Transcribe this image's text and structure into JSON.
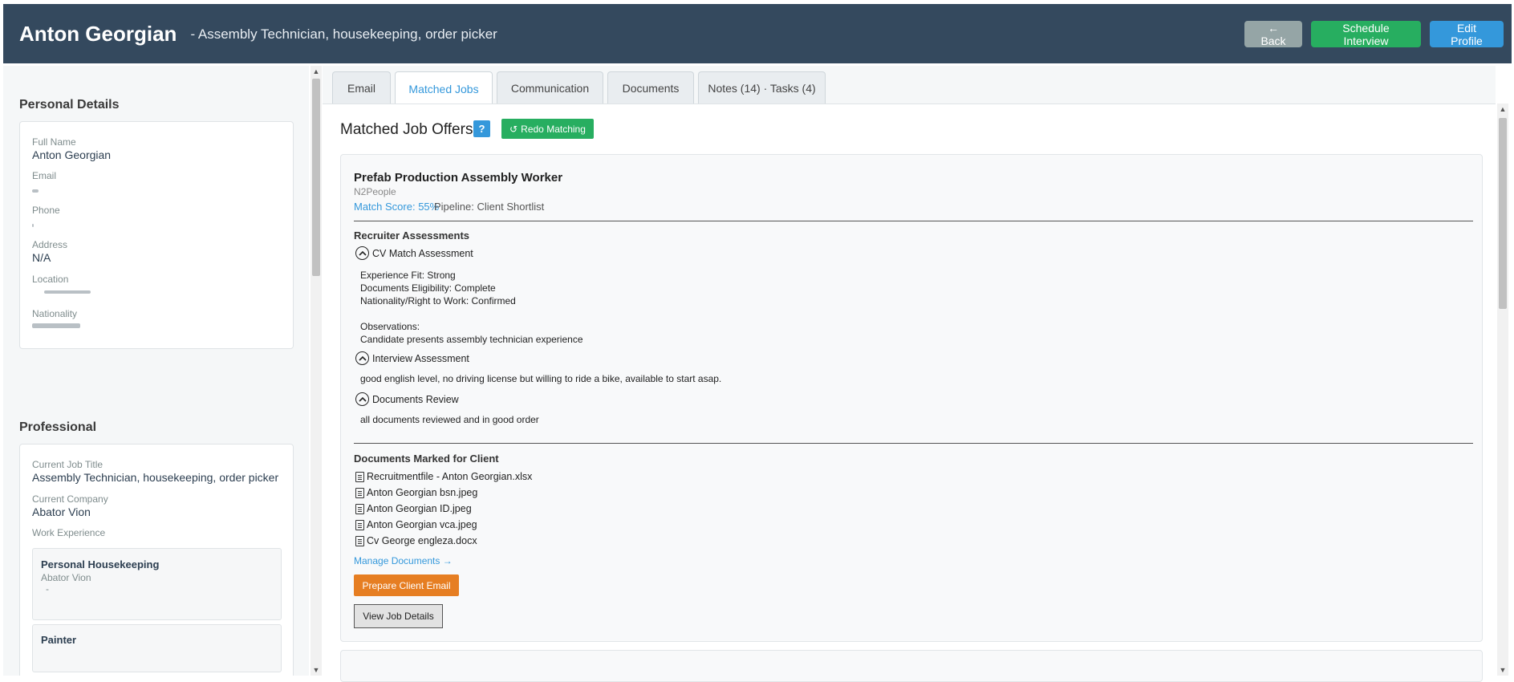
{
  "header": {
    "name": "Anton Georgian",
    "subtitle": "- Assembly Technician, housekeeping, order picker",
    "back_label": "← Back",
    "schedule_label": "Schedule Interview",
    "edit_label": "Edit Profile"
  },
  "personal": {
    "title": "Personal Details",
    "full_name_label": "Full Name",
    "full_name": "Anton Georgian",
    "email_label": "Email",
    "phone_label": "Phone",
    "address_label": "Address",
    "address": "N/A",
    "location_label": "Location",
    "nationality_label": "Nationality"
  },
  "professional": {
    "title": "Professional",
    "job_title_label": "Current Job Title",
    "job_title": "Assembly Technician, housekeeping, order picker",
    "company_label": "Current Company",
    "company": "Abator Vion",
    "work_exp_label": "Work Experience",
    "work_experience": [
      {
        "title": "Personal Housekeeping",
        "company": "Abator Vion",
        "period": "-"
      },
      {
        "title": "Painter"
      }
    ]
  },
  "tabs": [
    {
      "label": "Email"
    },
    {
      "label": "Matched Jobs"
    },
    {
      "label": "Communication"
    },
    {
      "label": "Documents"
    },
    {
      "label": "Notes (14) · Tasks (4)"
    }
  ],
  "matched": {
    "title": "Matched Job Offers",
    "help": "?",
    "redo_icon": "↺",
    "redo_label": "Redo Matching",
    "job": {
      "title": "Prefab Production Assembly Worker",
      "company": "N2People",
      "match_score": "Match Score: 55%",
      "pipeline": "Pipeline: Client Shortlist",
      "recruiter_title": "Recruiter Assessments",
      "cv_label": "CV Match Assessment",
      "cv_text": "Experience Fit: Strong\nDocuments Eligibility: Complete\nNationality/Right to Work: Confirmed\n\nObservations:\nCandidate presents assembly technician experience",
      "interview_label": "Interview Assessment",
      "interview_text": "good english level, no driving license but willing to ride a bike, available to start asap.",
      "docs_review_label": "Documents Review",
      "docs_review_text": "all documents reviewed and in good order",
      "docs_title": "Documents Marked for Client",
      "documents": [
        "Recruitmentfile - Anton Georgian.xlsx",
        "Anton Georgian bsn.jpeg",
        "Anton Georgian ID.jpeg",
        "Anton Georgian vca.jpeg",
        "Cv George engleza.docx"
      ],
      "manage_label": "Manage Documents →",
      "prepare_label": "Prepare Client Email",
      "view_label": "View Job Details"
    }
  },
  "colors": {
    "header_bg": "#34495e",
    "primary": "#3498db",
    "success": "#27ae60",
    "warning": "#e67e22",
    "muted": "#95a5a6"
  }
}
